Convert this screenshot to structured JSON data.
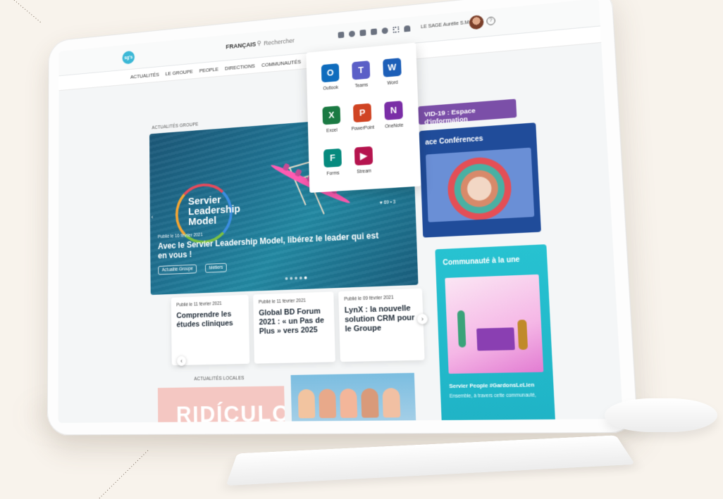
{
  "topbar": {
    "logo_text": "sg's",
    "language": "FRANÇAIS",
    "search_placeholder": "Rechercher",
    "user_name": "LE SAGE Aurélie S.MONDE",
    "help": "?"
  },
  "nav": {
    "items": [
      "ACTUALITÉS",
      "LE GROUPE",
      "PEOPLE",
      "DIRECTIONS",
      "COMMUNAUTÉS"
    ]
  },
  "apps_menu": {
    "apps": [
      {
        "name": "Outlook",
        "letter": "O",
        "color": "#0f6cbd"
      },
      {
        "name": "Teams",
        "letter": "T",
        "color": "#5b5fc7"
      },
      {
        "name": "Word",
        "letter": "W",
        "color": "#1d5fb8"
      },
      {
        "name": "Excel",
        "letter": "X",
        "color": "#1b7a43"
      },
      {
        "name": "PowerPoint",
        "letter": "P",
        "color": "#d04423"
      },
      {
        "name": "OneNote",
        "letter": "N",
        "color": "#7a2ea6"
      },
      {
        "name": "Forms",
        "letter": "F",
        "color": "#068a7e"
      },
      {
        "name": "Stream",
        "letter": "▶",
        "color": "#b5144e"
      }
    ]
  },
  "group_news": {
    "section_label": "ACTUALITÉS GROUPE",
    "hero": {
      "logo_lines": [
        "Servier",
        "Leadership",
        "Model"
      ],
      "date": "Publié le 16 février 2021",
      "title": "Avec le Servier Leadership Model, libérez le leader qui est en vous !",
      "tags": [
        "Actualité Groupe",
        "Métiers"
      ],
      "likes": "69",
      "comments": "3"
    },
    "cards": [
      {
        "date": "Publié le 11 février 2021",
        "title": "Comprendre les études cliniques"
      },
      {
        "date": "Publié le 11 février 2021",
        "title": "Global BD Forum 2021 : « un Pas de Plus » vers 2025"
      },
      {
        "date": "Publié le 09 février 2021",
        "title": "LynX : la nouvelle solution CRM pour le Groupe"
      }
    ]
  },
  "local_news": {
    "section_label": "ACTUALITÉS LOCALES",
    "banner_text": "RIDÍCULO"
  },
  "right_column": {
    "covid_label": "VID-19 : Espace d'information",
    "conferences_title": "ace Conférences",
    "community_title": "Communauté à la une",
    "community_subtitle": "Servier People #GardonsLeLien",
    "community_desc": "Ensemble, à travers cette communauté,"
  },
  "colors": {
    "accent": "#3cb8d6",
    "covid": "#7b4fa8",
    "conferences": "#204c9a",
    "community": "#27c2d1",
    "background": "#f8f3ec"
  }
}
